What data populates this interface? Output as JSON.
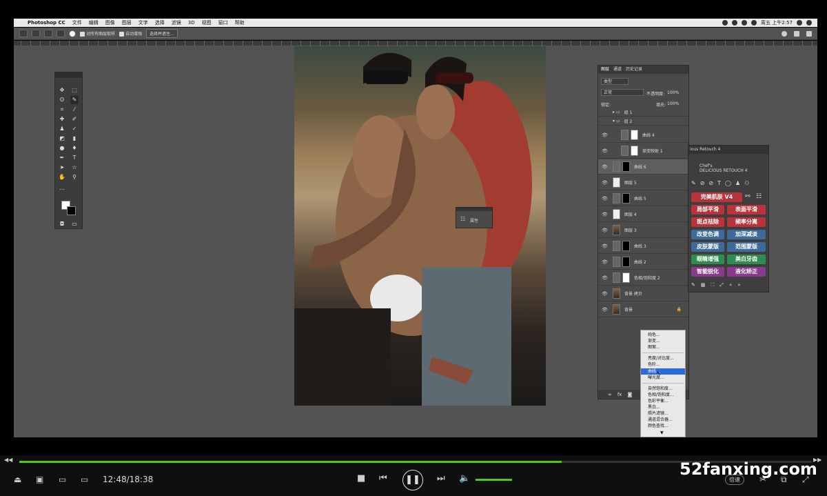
{
  "menubar": {
    "apple": "",
    "app_name": "Photoshop CC",
    "items": [
      "文件",
      "编辑",
      "图像",
      "图层",
      "文字",
      "选择",
      "滤镜",
      "3D",
      "视图",
      "窗口",
      "帮助"
    ],
    "clock": "周五 上午2:57"
  },
  "options_bar": {
    "sample_all_layers": "对所有图层取样",
    "auto_enhance": "自动增强",
    "select_and_mask": "选择并遮住..."
  },
  "layers_panel": {
    "tabs": [
      "图层",
      "通道",
      "历史记录"
    ],
    "filter": "类型",
    "blend_mode": "正常",
    "opacity_label": "不透明度:",
    "opacity_value": "100%",
    "lock_label": "锁定:",
    "fill_label": "填充:",
    "fill_value": "100%",
    "layers": [
      {
        "name": "组 1"
      },
      {
        "name": "组 2"
      },
      {
        "name": "曲线 4"
      },
      {
        "name": "渐变映射 1"
      },
      {
        "name": "曲线 6"
      },
      {
        "name": "图层 5"
      },
      {
        "name": "曲线 5"
      },
      {
        "name": "图层 4"
      },
      {
        "name": "图层 3"
      },
      {
        "name": "曲线 3"
      },
      {
        "name": "曲线 2"
      },
      {
        "name": "色相/饱和度 2"
      },
      {
        "name": "背景 拷贝"
      },
      {
        "name": "背景"
      }
    ]
  },
  "properties_panel": {
    "label": "属性"
  },
  "retouch_panel": {
    "tab": "ious Retouch 4",
    "brand_line1": "Chef's",
    "brand_line2": "DELICIOUS RETOUCH 4",
    "buttons": [
      {
        "label": "完美肌肤 V4",
        "color": "#b8333a"
      },
      {
        "label": "局部平滑",
        "color": "#b8333a"
      },
      {
        "label": "表面平滑",
        "color": "#b8333a"
      },
      {
        "label": "斑点祛除",
        "color": "#b8333a"
      },
      {
        "label": "频率分离",
        "color": "#b8333a"
      },
      {
        "label": "改变色调",
        "color": "#3d6a9a"
      },
      {
        "label": "加深减淡",
        "color": "#3d6a9a"
      },
      {
        "label": "皮肤蒙版",
        "color": "#3d6a9a"
      },
      {
        "label": "范围蒙版",
        "color": "#3d6a9a"
      },
      {
        "label": "眼睛增强",
        "color": "#2e8c4e"
      },
      {
        "label": "美白牙齿",
        "color": "#2e8c4e"
      },
      {
        "label": "智能锐化",
        "color": "#8a3a8a"
      },
      {
        "label": "液化矫正",
        "color": "#8a3a8a"
      }
    ]
  },
  "context_menu": {
    "items": [
      "纯色...",
      "渐变...",
      "图案...",
      "亮度/对比度...",
      "色阶...",
      "曲线...",
      "曝光度...",
      "自然饱和度...",
      "色相/饱和度...",
      "色彩平衡...",
      "黑白...",
      "照片滤镜...",
      "通道混合器...",
      "颜色查找..."
    ],
    "highlighted": "曲线..."
  },
  "player": {
    "time": "12:48/18:38",
    "progress": 0.684,
    "speed": "倍速",
    "volume": 1.0
  },
  "watermark": "52fanxing.com"
}
